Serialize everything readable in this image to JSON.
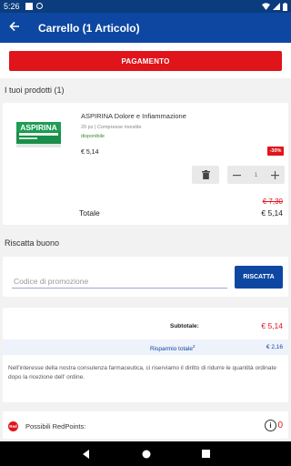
{
  "status_bar": {
    "time": "5:26"
  },
  "app_bar": {
    "back_icon": "arrow-left-icon",
    "title": "Carrello (1 Articolo)"
  },
  "checkout": {
    "pay_label": "PAGAMENTO"
  },
  "products_section": {
    "title": "I tuoi prodotti (1)",
    "items": [
      {
        "image_alt": "ASPIRINA",
        "name": "ASPIRINA Dolore e Infiammazione",
        "subtitle": "20 pz | Compresse rivestite",
        "availability": "disponibile",
        "price": "€ 5,14",
        "discount": "-30%",
        "quantity": "1",
        "old_price": "€ 7,30"
      }
    ],
    "total_label": "Totale",
    "total_value": "€ 5,14"
  },
  "coupon": {
    "title": "Riscatta buono",
    "input_placeholder": "Codice di promozione",
    "redeem_label": "RISCATTA"
  },
  "summary": {
    "subtotal_label": "Subtotale:",
    "subtotal_value": "€ 5,14",
    "savings_label": "Risparmio totale",
    "savings_value": "€ 2,16",
    "note": "Nell'interesse della nostra consulenza farmaceutica, ci riserviamo il diritto di ridurre le quantità ordinate dopo la ricezione dell' ordine."
  },
  "redpoints": {
    "icon_text": "Red",
    "label": "Possibili RedPoints:",
    "value": "0"
  },
  "colors": {
    "primary_blue": "#0d47a1",
    "status_blue": "#0b3c7d",
    "brand_red": "#e0141b",
    "background": "#f2f2f2"
  }
}
